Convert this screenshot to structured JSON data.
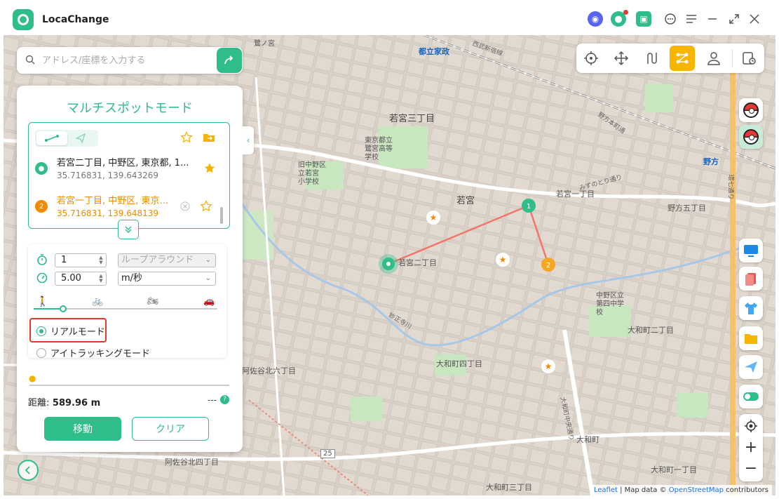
{
  "app": {
    "title": "LocaChange"
  },
  "search": {
    "placeholder": "アドレス/座標を入力する"
  },
  "panel": {
    "title": "マルチスポットモード",
    "spots": [
      {
        "name": "若宮二丁目, 中野区, 東京都, 1...",
        "coords": "35.716831, 139.643269",
        "marker": "start"
      },
      {
        "name": "若宮一丁目, 中野区, 東京...",
        "coords": "35.716831, 139.648139",
        "marker": "2"
      }
    ],
    "settings": {
      "repeat_count": "1",
      "loop_mode": "ループアラウンド",
      "speed": "5.00",
      "speed_unit": "m/秒",
      "speed_level": 0.16,
      "real_mode": "リアルモード",
      "eye_tracking_mode": "アイトラッキングモード"
    },
    "distance_label": "距離:",
    "distance_value": "589.96 m",
    "time": "---",
    "move_label": "移動",
    "clear_label": "クリア"
  },
  "map": {
    "labels": {
      "wakamiya_3": "若宮三丁目",
      "wakamiya_2": "若宮二丁目",
      "wakamiya": "若宮",
      "wakamiya_1": "若宮一丁目",
      "nogata_5": "野方五丁目",
      "nogata": "野方",
      "toritsu_kasei": "都立家政",
      "school_tokyo": "東京都立\n鷺宮高等\n学校",
      "school_nakano": "旧中野区\n立若宮\n小学校",
      "school_dai4": "中野区立\n第四中学\n校",
      "yamato_2": "大和町二丁目",
      "yamato_4": "大和町四丁目",
      "yamato_3": "大和町三丁目",
      "yamato": "大和町",
      "yamato_1": "大和町一丁目",
      "asagaya_6": "阿佐谷北六丁目",
      "asagaya_4": "阿佐谷北四丁目",
      "sagimiya": "鷺ノ宮",
      "myoshoji": "妙正寺川",
      "mizutori": "みずのとり通り",
      "nogata_honmachi": "野方本町通",
      "nishitoku": "西武新宿線",
      "route_25": "25",
      "yamato_dori": "大和町中央通り",
      "kanjo": "環七通り"
    },
    "attribution_leaflet": "Leaflet",
    "attribution_mid": " | Map data © ",
    "attribution_osm": "OpenStreetMap",
    "attribution_end": " contributors"
  },
  "colors": {
    "accent": "#2fbd8a",
    "route": "#f0776a",
    "waypoint_2": "#f5a623",
    "highlight": "#e03a2a",
    "mode_active": "#f7b500"
  }
}
